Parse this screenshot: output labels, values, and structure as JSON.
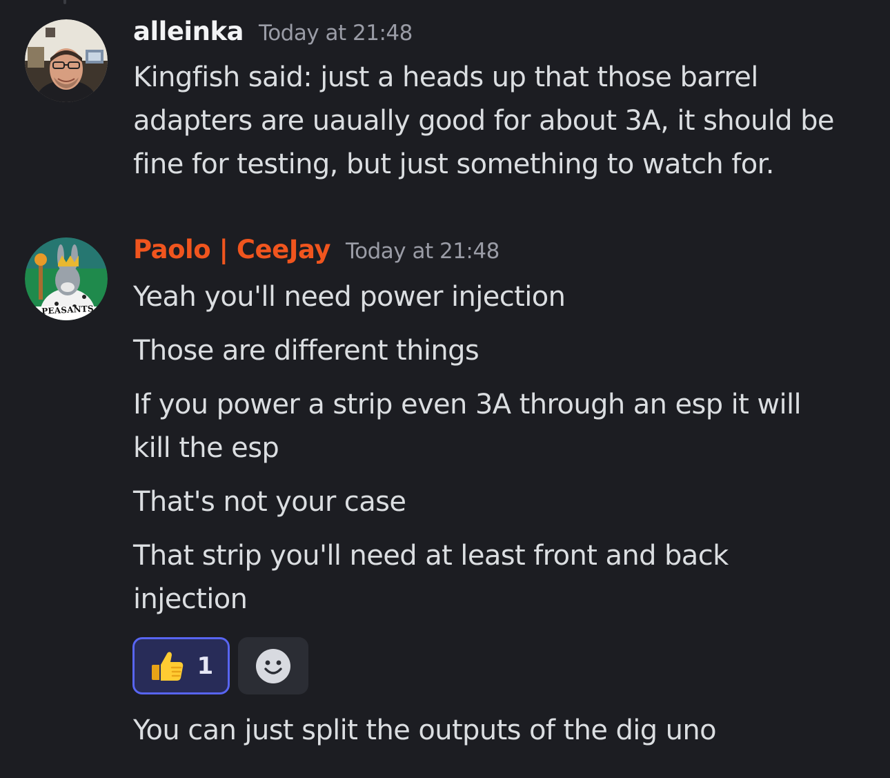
{
  "messages": [
    {
      "author": "alleinka",
      "timestamp": "Today at 21:48",
      "name_color": "#f2f3f5",
      "lines": [
        "Kingfish said: just a heads up that those barrel",
        "adapters are uaually good for about 3A, it should be",
        "fine for testing, but just something to watch for."
      ]
    },
    {
      "author": "Paolo | CeeJay",
      "timestamp": "Today at 21:48",
      "name_color": "#f0551e",
      "avatar_text": "PEASANTS",
      "lines": [
        "Yeah you'll need power injection",
        "Those are different things",
        "If you power a strip even 3A through an esp it will",
        "kill the esp",
        "That's not your case",
        "That strip you'll need at least front and back",
        "injection",
        "You can just split the outputs of the dig uno"
      ]
    }
  ],
  "reactions": [
    {
      "emoji": "thumbs-up",
      "count": "1",
      "active": true
    },
    {
      "emoji": "add-reaction",
      "icon": "smiley-icon"
    }
  ],
  "colors": {
    "background": "#1c1d22",
    "text": "#dbdee1",
    "timestamp": "#9a9ca6",
    "reaction_active_bg": "#282c58",
    "reaction_active_border": "#5865f2"
  }
}
